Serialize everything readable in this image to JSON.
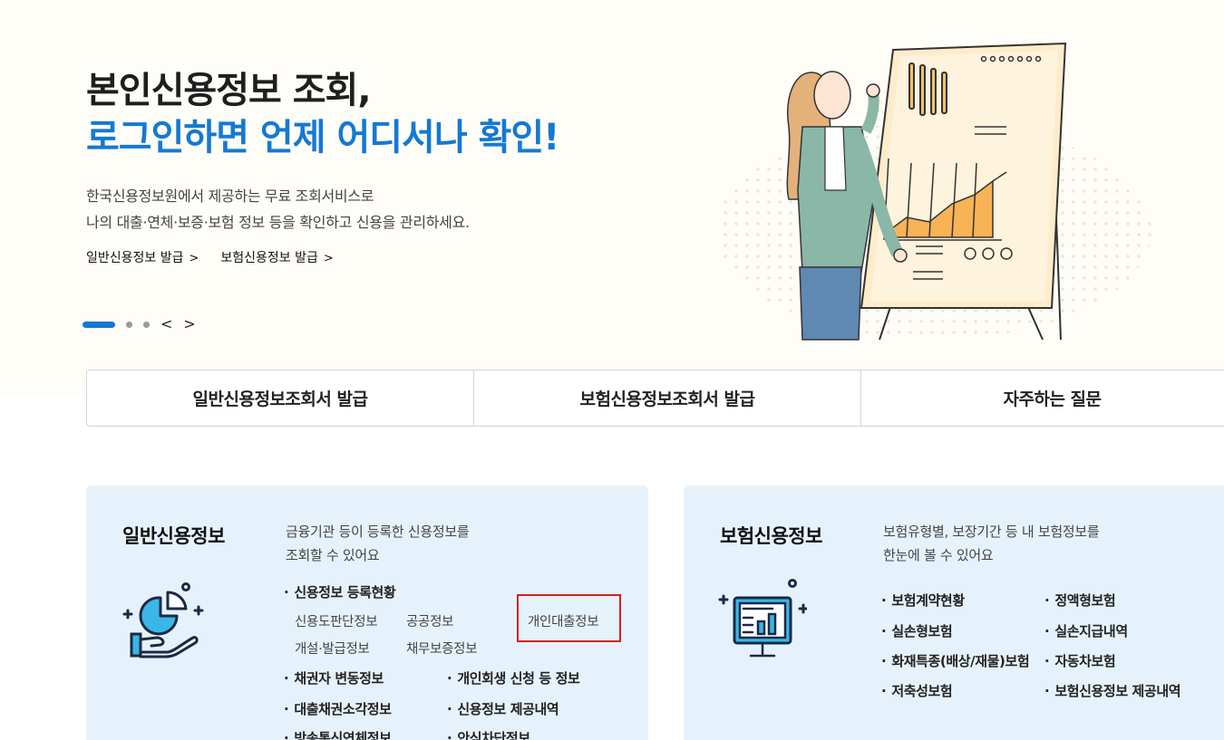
{
  "hero": {
    "title_line1": "본인신용정보 조회,",
    "title_line2": "로그인하면 언제 어디서나 확인!",
    "desc_line1": "한국신용정보원에서 제공하는 무료 조회서비스로",
    "desc_line2": "나의 대출·연체·보증·보험 정보 등을 확인하고 신용을 관리하세요.",
    "links": [
      {
        "label": "일반신용정보 발급",
        "chevron": ">"
      },
      {
        "label": "보험신용정보 발급",
        "chevron": ">"
      }
    ],
    "pager": {
      "prev": "<",
      "next": ">",
      "total": 3,
      "active": 1
    }
  },
  "tabs": [
    {
      "label": "일반신용정보조회서 발급"
    },
    {
      "label": "보험신용정보조회서 발급"
    },
    {
      "label": "자주하는 질문"
    }
  ],
  "general_card": {
    "title": "일반신용정보",
    "desc_line1": "금융기관 등이 등록한 신용정보를",
    "desc_line2": "조회할 수 있어요",
    "section": "신용정보 등록현황",
    "sub_items": [
      "신용도판단정보",
      "공공정보",
      "개인대출정보",
      "개설·발급정보",
      "채무보증정보"
    ],
    "items": [
      "채권자 변동정보",
      "개인회생 신청 등 정보",
      "대출채권소각정보",
      "신용정보 제공내역",
      "방송통신연체정보",
      "안심차단정보"
    ],
    "icon": "hand-pie-chart-icon"
  },
  "insurance_card": {
    "title": "보험신용정보",
    "desc_line1": "보험유형별, 보장기간 등 내 보험정보를",
    "desc_line2": "한눈에 볼 수 있어요",
    "items": [
      "보험계약현황",
      "정액형보험",
      "실손형보험",
      "실손지급내역",
      "화재특종(배상/재물)보험",
      "자동차보험",
      "저축성보험",
      "보험신용정보 제공내역"
    ],
    "icon": "monitor-bar-chart-icon"
  },
  "colors": {
    "accent": "#1479d3",
    "hero_bg": "#fffdf7",
    "card_bg": "#e6f2fb",
    "highlight_border": "#d61f1f"
  }
}
